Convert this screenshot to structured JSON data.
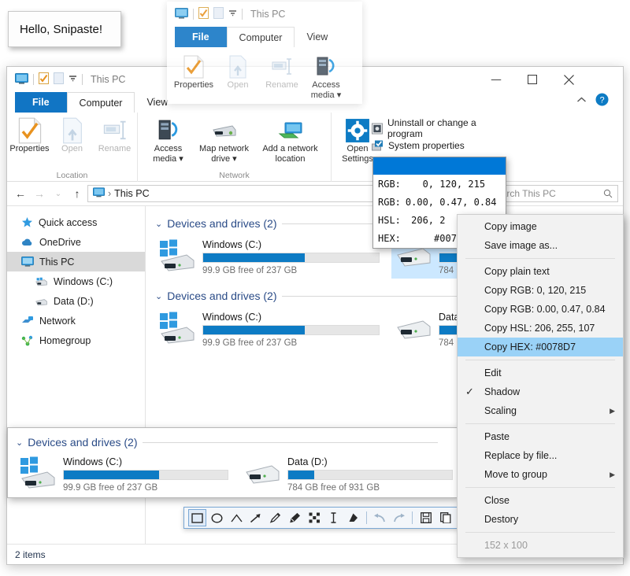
{
  "hello_note": {
    "text": "Hello, Snipaste!"
  },
  "ghost_window": {
    "title": "This PC",
    "tabs": [
      {
        "label": "File"
      },
      {
        "label": "Computer"
      },
      {
        "label": "View"
      }
    ],
    "ribbon_buttons": [
      {
        "label": "Properties",
        "icon": "properties-icon",
        "disabled": false
      },
      {
        "label": "Open",
        "icon": "open-icon",
        "disabled": true
      },
      {
        "label": "Rename",
        "icon": "rename-icon",
        "disabled": true
      },
      {
        "label": "Access media ▾",
        "icon": "access-media-icon",
        "disabled": false
      }
    ]
  },
  "main_window": {
    "title": "This PC",
    "window_controls": {
      "minimize": "—",
      "maximize": "▢",
      "close": "✕",
      "ribbon_collapse": "⌃",
      "help": "?"
    },
    "tabs": [
      {
        "label": "File"
      },
      {
        "label": "Computer"
      },
      {
        "label": "View"
      }
    ],
    "ribbon_groups": [
      {
        "label": "Location",
        "buttons": [
          {
            "label": "Properties",
            "icon": "properties-icon",
            "disabled": false
          },
          {
            "label": "Open",
            "icon": "open-icon",
            "disabled": true
          },
          {
            "label": "Rename",
            "icon": "rename-icon",
            "disabled": true
          }
        ]
      },
      {
        "label": "Network",
        "buttons": [
          {
            "label": "Access media ▾",
            "icon": "access-media-icon",
            "disabled": false
          },
          {
            "label": "Map network drive ▾",
            "icon": "map-network-drive-icon",
            "disabled": false
          },
          {
            "label": "Add a network location",
            "icon": "add-network-location-icon",
            "disabled": false
          }
        ]
      },
      {
        "label": "",
        "buttons": [
          {
            "label": "Open Settings",
            "icon": "open-settings-icon",
            "disabled": false
          }
        ]
      }
    ],
    "system_shortcuts": [
      {
        "label": "Uninstall or change a program",
        "icon": "uninstall-program-icon"
      },
      {
        "label": "System properties",
        "icon": "system-properties-icon"
      }
    ],
    "address_bar": {
      "back": "←",
      "forward": "→",
      "recent": "⌄",
      "up": "↑",
      "breadcrumb_icon": "this-pc-icon",
      "breadcrumb": "This PC",
      "separator": "›",
      "search_placeholder": "Search This PC",
      "search_icon": "search-icon"
    },
    "nav_pane": [
      {
        "label": "Quick access",
        "icon": "star-icon",
        "selected": false,
        "child": false
      },
      {
        "label": "OneDrive",
        "icon": "cloud-icon",
        "selected": false,
        "child": false
      },
      {
        "label": "This PC",
        "icon": "monitor-icon",
        "selected": true,
        "child": false
      },
      {
        "label": "Windows (C:)",
        "icon": "windows-drive-icon",
        "selected": false,
        "child": true
      },
      {
        "label": "Data (D:)",
        "icon": "drive-icon",
        "selected": false,
        "child": true
      },
      {
        "label": "Network",
        "icon": "network-icon",
        "selected": false,
        "child": false
      },
      {
        "label": "Homegroup",
        "icon": "homegroup-icon",
        "selected": false,
        "child": false
      }
    ],
    "groups": [
      {
        "header": "Devices and drives (2)",
        "chevron": "⌄",
        "drives": [
          {
            "name": "Windows (C:)",
            "free_text": "99.9 GB free of 237 GB",
            "used_percent": 58,
            "icon": "windows-drive-icon",
            "selected": false
          },
          {
            "name": "Data (D:)",
            "free_text": "784 GB free of 931 GB",
            "used_percent": 16,
            "icon": "drive-icon",
            "selected": true
          }
        ]
      },
      {
        "header": "Devices and drives (2)",
        "chevron": "⌄",
        "drives": [
          {
            "name": "Windows (C:)",
            "free_text": "99.9 GB free of 237 GB",
            "used_percent": 58,
            "icon": "windows-drive-icon",
            "selected": false
          },
          {
            "name": "Data (D:)",
            "free_text": "784 GB free of 931 GB",
            "used_percent": 16,
            "icon": "drive-icon",
            "selected": false
          }
        ]
      }
    ],
    "status": "2 items"
  },
  "snippet_panel": {
    "header": "Devices and drives (2)",
    "chevron": "⌄",
    "drives": [
      {
        "name": "Windows (C:)",
        "free_text": "99.9 GB free of 237 GB",
        "used_percent": 58,
        "icon": "windows-drive-icon"
      },
      {
        "name": "Data (D:)",
        "free_text": "784 GB free of 931 GB",
        "used_percent": 16,
        "icon": "drive-icon"
      }
    ]
  },
  "annotation_toolbar": {
    "tools": [
      {
        "name": "rectangle-tool",
        "glyph": "▭"
      },
      {
        "name": "ellipse-tool",
        "glyph": "◯"
      },
      {
        "name": "arc-tool",
        "glyph": "⌃"
      },
      {
        "name": "arrow-tool",
        "glyph": "↗"
      },
      {
        "name": "pencil-tool",
        "glyph": "✐"
      },
      {
        "name": "marker-tool",
        "glyph": "🖍"
      },
      {
        "name": "mosaic-tool",
        "glyph": "▚"
      },
      {
        "name": "text-tool",
        "glyph": "I"
      },
      {
        "name": "eraser-tool",
        "glyph": "◆"
      },
      {
        "name": "undo-button",
        "glyph": "↰"
      },
      {
        "name": "redo-button",
        "glyph": "↱"
      },
      {
        "name": "save-button",
        "glyph": "▤"
      },
      {
        "name": "copy-button",
        "glyph": "❐"
      }
    ]
  },
  "color_hud": {
    "swatch_color": "#0078D7",
    "rows": [
      {
        "label": "RGB:",
        "value": "   0, 120, 215"
      },
      {
        "label": "RGB:",
        "value": "0.00, 0.47, 0.84"
      },
      {
        "label": "HSL:",
        "value": " 206, 2"
      },
      {
        "label": "HEX:",
        "value": "     #007"
      }
    ]
  },
  "context_menu": {
    "items": [
      {
        "label": "Copy image",
        "type": "item"
      },
      {
        "label": "Save image as...",
        "type": "item"
      },
      {
        "type": "separator"
      },
      {
        "label": "Copy plain text",
        "type": "item"
      },
      {
        "label": "Copy RGB: 0, 120, 215",
        "type": "item"
      },
      {
        "label": "Copy RGB: 0.00, 0.47, 0.84",
        "type": "item"
      },
      {
        "label": "Copy HSL: 206, 255, 107",
        "type": "item"
      },
      {
        "label": "Copy HEX: #0078D7",
        "type": "item",
        "highlighted": true
      },
      {
        "type": "separator"
      },
      {
        "label": "Edit",
        "type": "item"
      },
      {
        "label": "Shadow",
        "type": "item",
        "checked": true
      },
      {
        "label": "Scaling",
        "type": "item",
        "submenu": true
      },
      {
        "type": "separator"
      },
      {
        "label": "Paste",
        "type": "item"
      },
      {
        "label": "Replace by file...",
        "type": "item"
      },
      {
        "label": "Move to group",
        "type": "item",
        "submenu": true
      },
      {
        "type": "separator"
      },
      {
        "label": "Close",
        "type": "item"
      },
      {
        "label": "Destory",
        "type": "item"
      },
      {
        "type": "separator"
      },
      {
        "label": "152 x 100",
        "type": "item",
        "disabled": true
      }
    ],
    "check_glyph": "✓",
    "submenu_glyph": "▶"
  }
}
